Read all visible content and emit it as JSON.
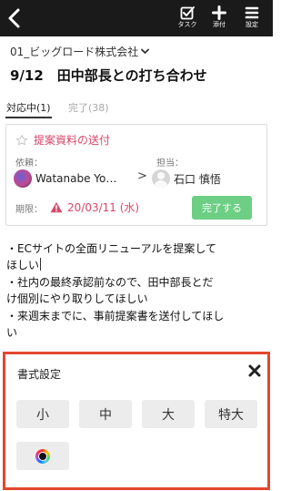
{
  "header": {
    "task_label": "タスク",
    "attach_label": "添付",
    "settings_label": "設定"
  },
  "company": "01_ビッグロード株式会社",
  "page_title": "9/12　田中部長との打ち合わせ",
  "tabs": {
    "active": "対応中",
    "active_count": "(1)",
    "done": "完了",
    "done_count": "(38)"
  },
  "task": {
    "title": "提案資料の送付",
    "requester_label": "依頼：",
    "requester_name": "Watanabe Yo…",
    "assignee_label": "担当：",
    "assignee_name": "石口 慎悟",
    "arrow": ">",
    "deadline_label": "期限：",
    "deadline": "20/03/11 (水)",
    "complete_button": "完了する"
  },
  "body_lines": [
    "・ECサイトの全面リニューアルを提案して",
    "ほしい",
    "・社内の最終承認前なので、田中部長とだ",
    "け個別にやり取りしてほしい",
    "・来週末までに、事前提案書を送付してほし",
    "い"
  ],
  "format_panel": {
    "title": "書式設定",
    "sizes": [
      "小",
      "中",
      "大",
      "特大"
    ]
  },
  "colors": {
    "accent_pink": "#d9486a",
    "complete_green": "#6ccf84",
    "highlight_border": "#e2472f",
    "topbar": "#1a1a1a"
  }
}
